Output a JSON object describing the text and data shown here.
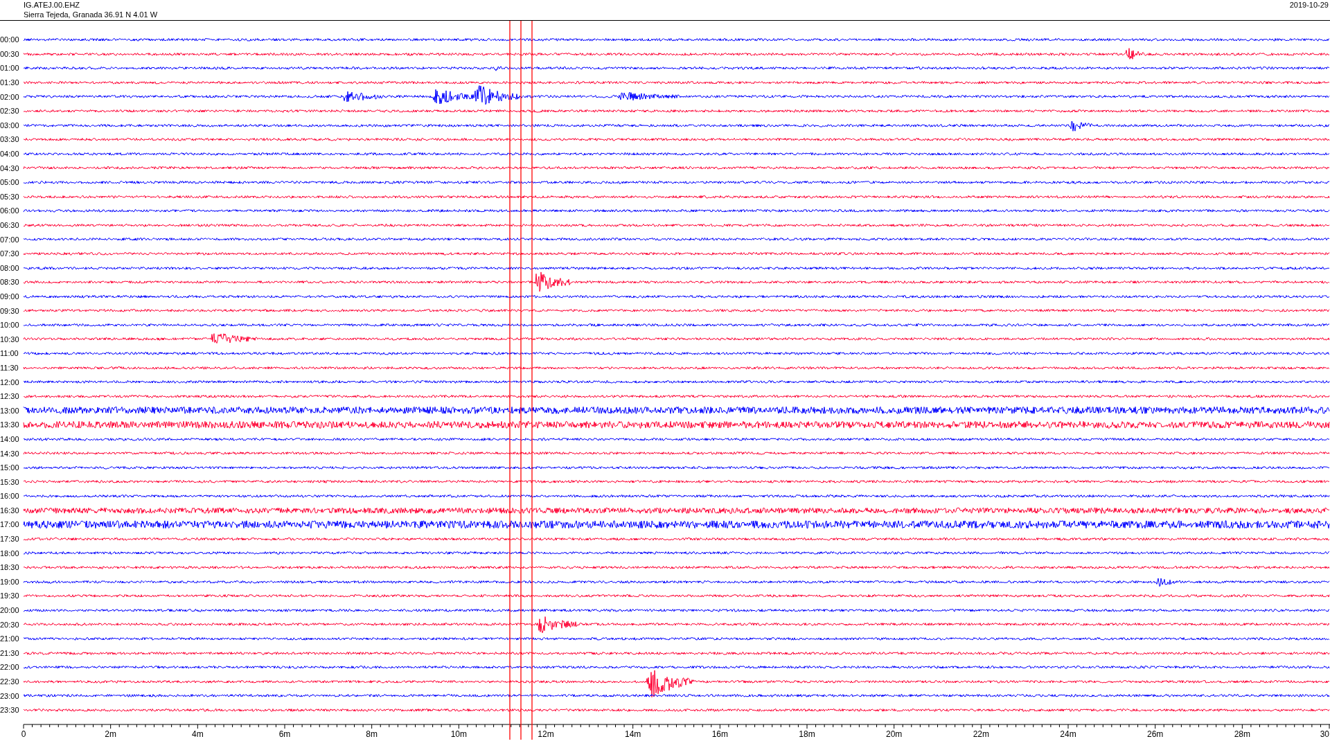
{
  "header": {
    "station": "IG.ATEJ.00.EHZ",
    "location": "Sierra Tejeda, Granada  36.91 N 4.01 W",
    "date": "2019-10-29"
  },
  "rows": [
    {
      "time": "00:00",
      "color": "#0000ff"
    },
    {
      "time": "00:30",
      "color": "#ff0033"
    },
    {
      "time": "01:00",
      "color": "#0000ff"
    },
    {
      "time": "01:30",
      "color": "#ff0033"
    },
    {
      "time": "02:00",
      "color": "#0000ff"
    },
    {
      "time": "02:30",
      "color": "#ff0033"
    },
    {
      "time": "03:00",
      "color": "#0000ff"
    },
    {
      "time": "03:30",
      "color": "#ff0033"
    },
    {
      "time": "04:00",
      "color": "#0000ff"
    },
    {
      "time": "04:30",
      "color": "#ff0033"
    },
    {
      "time": "05:00",
      "color": "#0000ff"
    },
    {
      "time": "05:30",
      "color": "#ff0033"
    },
    {
      "time": "06:00",
      "color": "#0000ff"
    },
    {
      "time": "06:30",
      "color": "#ff0033"
    },
    {
      "time": "07:00",
      "color": "#0000ff"
    },
    {
      "time": "07:30",
      "color": "#ff0033"
    },
    {
      "time": "08:00",
      "color": "#0000ff"
    },
    {
      "time": "08:30",
      "color": "#ff0033"
    },
    {
      "time": "09:00",
      "color": "#0000ff"
    },
    {
      "time": "09:30",
      "color": "#ff0033"
    },
    {
      "time": "10:00",
      "color": "#0000ff"
    },
    {
      "time": "10:30",
      "color": "#ff0033"
    },
    {
      "time": "11:00",
      "color": "#0000ff"
    },
    {
      "time": "11:30",
      "color": "#ff0033"
    },
    {
      "time": "12:00",
      "color": "#0000ff"
    },
    {
      "time": "12:30",
      "color": "#ff0033"
    },
    {
      "time": "13:00",
      "color": "#0000ff"
    },
    {
      "time": "13:30",
      "color": "#ff0033"
    },
    {
      "time": "14:00",
      "color": "#0000ff"
    },
    {
      "time": "14:30",
      "color": "#ff0033"
    },
    {
      "time": "15:00",
      "color": "#0000ff"
    },
    {
      "time": "15:30",
      "color": "#ff0033"
    },
    {
      "time": "16:00",
      "color": "#0000ff"
    },
    {
      "time": "16:30",
      "color": "#ff0033"
    },
    {
      "time": "17:00",
      "color": "#0000ff"
    },
    {
      "time": "17:30",
      "color": "#ff0033"
    },
    {
      "time": "18:00",
      "color": "#0000ff"
    },
    {
      "time": "18:30",
      "color": "#ff0033"
    },
    {
      "time": "19:00",
      "color": "#0000ff"
    },
    {
      "time": "19:30",
      "color": "#ff0033"
    },
    {
      "time": "20:00",
      "color": "#0000ff"
    },
    {
      "time": "20:30",
      "color": "#ff0033"
    },
    {
      "time": "21:00",
      "color": "#0000ff"
    },
    {
      "time": "21:30",
      "color": "#ff0033"
    },
    {
      "time": "22:00",
      "color": "#0000ff"
    },
    {
      "time": "22:30",
      "color": "#ff0033"
    },
    {
      "time": "23:00",
      "color": "#0000ff"
    },
    {
      "time": "23:30",
      "color": "#ff0033"
    }
  ],
  "x_axis": {
    "labels": [
      "0",
      "2m",
      "4m",
      "6m",
      "8m",
      "10m",
      "12m",
      "14m",
      "16m",
      "18m",
      "20m",
      "22m",
      "24m",
      "26m",
      "28m",
      "30"
    ]
  }
}
